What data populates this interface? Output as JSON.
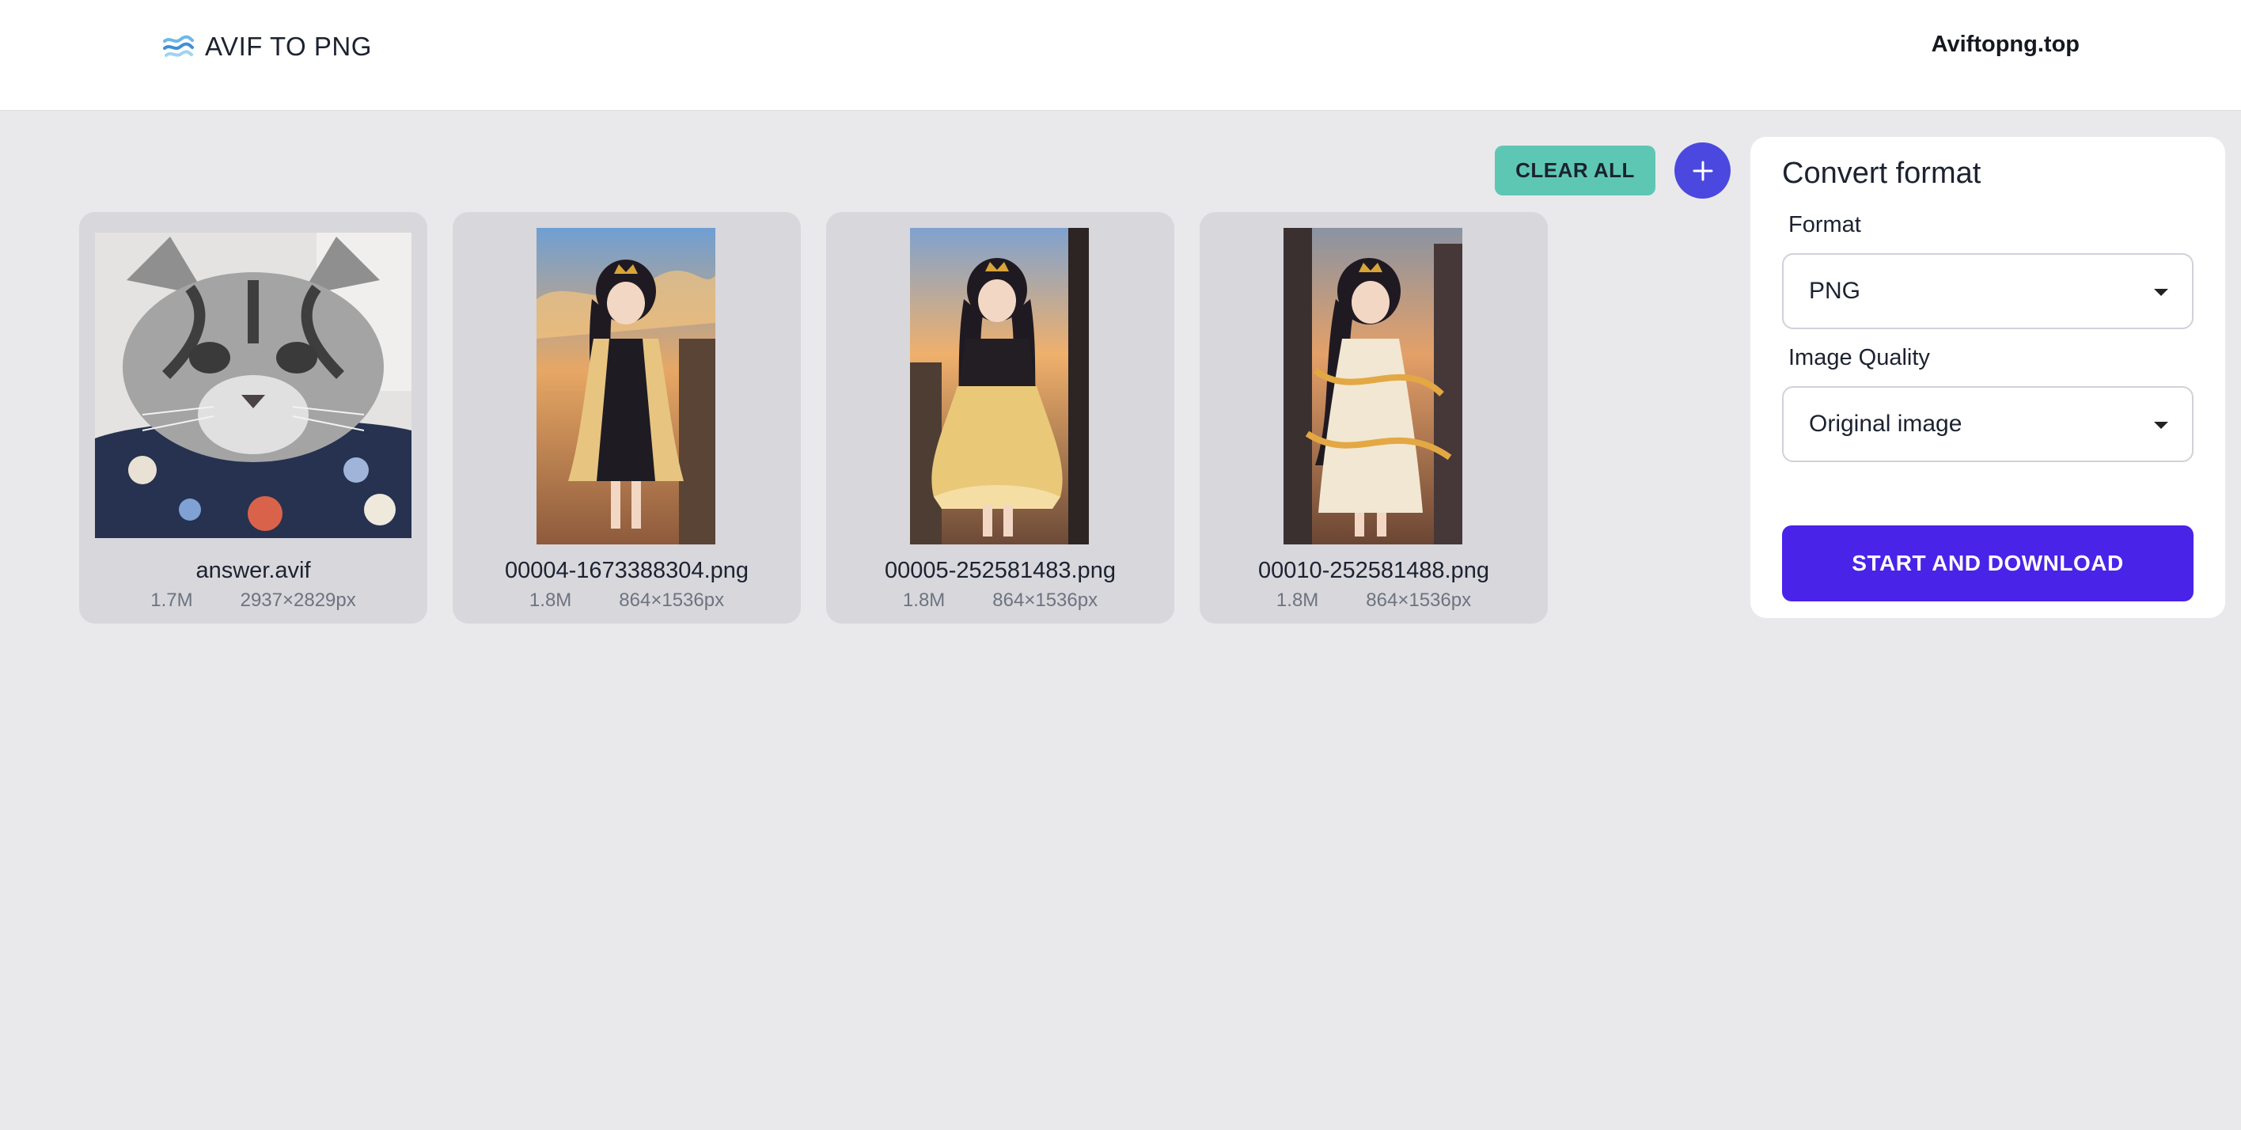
{
  "header": {
    "brand_icon": "waves-logo-icon",
    "title": "AVIF TO PNG",
    "site": "Aviftopng.top"
  },
  "toolbar": {
    "clear_all_label": "CLEAR ALL",
    "add_icon": "plus-icon"
  },
  "files": [
    {
      "name": "answer.avif",
      "size": "1.7M",
      "dimensions": "2937×2829px",
      "thumbnail": "cat-photo"
    },
    {
      "name": "00004-1673388304.png",
      "size": "1.8M",
      "dimensions": "864×1536px",
      "thumbnail": "anime-girl-black-dress"
    },
    {
      "name": "00005-252581483.png",
      "size": "1.8M",
      "dimensions": "864×1536px",
      "thumbnail": "anime-girl-yellow-dress"
    },
    {
      "name": "00010-252581488.png",
      "size": "1.8M",
      "dimensions": "864×1536px",
      "thumbnail": "anime-girl-white-dress"
    }
  ],
  "panel": {
    "title": "Convert format",
    "format_label": "Format",
    "format_value": "PNG",
    "quality_label": "Image Quality",
    "quality_value": "Original image",
    "start_label": "START AND DOWNLOAD"
  },
  "colors": {
    "accent": "#4a23e8",
    "add_button": "#4b48e0",
    "clear_button": "#5ec7b3",
    "background": "#e9e9ec"
  }
}
